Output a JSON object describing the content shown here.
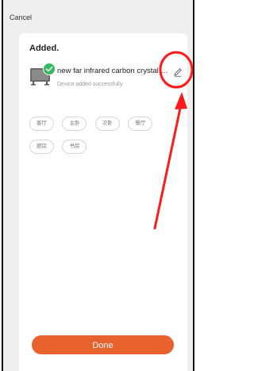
{
  "header": {
    "cancel_label": "Cancel"
  },
  "content": {
    "title": "Added.",
    "device": {
      "name": "new far infrared carbon crystal h...",
      "status": "Device added successfully"
    },
    "rooms": [
      "客厅",
      "主卧",
      "次卧",
      "餐厅",
      "厨房",
      "书房"
    ]
  },
  "footer": {
    "done_label": "Done"
  },
  "colors": {
    "accent": "#e8622e",
    "success": "#34b864",
    "annotation": "#ff1a1a"
  }
}
